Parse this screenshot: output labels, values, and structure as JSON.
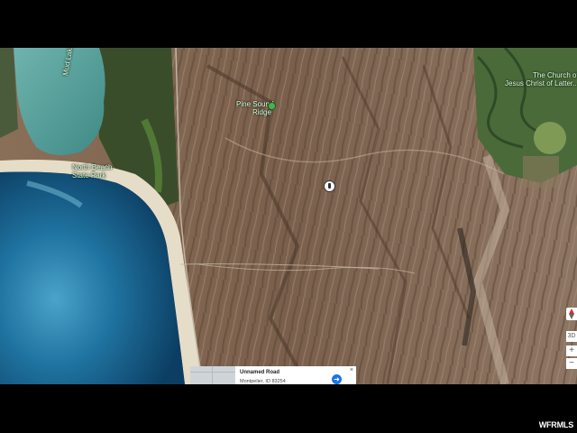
{
  "map": {
    "type": "satellite",
    "labels": {
      "mud_lake": "Mud Lake",
      "north_beach": "North Beach",
      "state_park": "State Park",
      "pine_sound": "Pine Sound",
      "ridge": "Ridge",
      "church_line1": "The Church of",
      "church_line2": "Jesus Christ of Latter..."
    }
  },
  "infocard": {
    "title": "Unnamed Road",
    "subtitle": "Montpelier, ID 83254",
    "close": "×",
    "directions_icon": "directions-icon"
  },
  "controls": {
    "three_d": "3D",
    "zoom_in": "+",
    "zoom_out": "−"
  },
  "watermark": "WFRMLS",
  "colors": {
    "lake_deep": "#0f4f7a",
    "lake_shallow": "#3b8fb4",
    "beach": "#e6ddc8",
    "terrain": "#7c6450",
    "vegetation": "#3e5a2f"
  }
}
